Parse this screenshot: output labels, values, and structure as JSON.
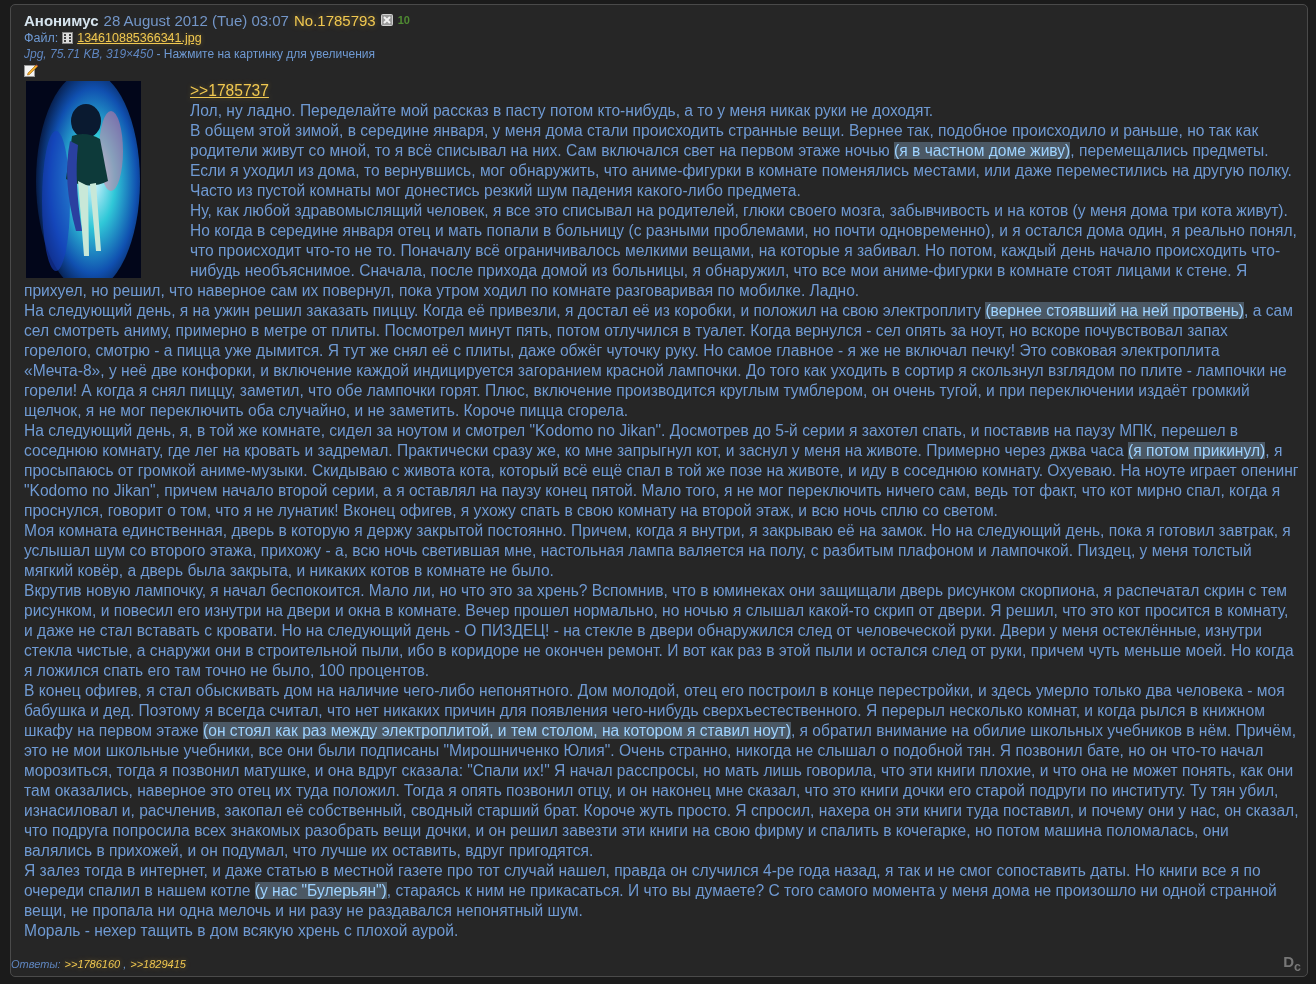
{
  "post": {
    "author": "Анонимус",
    "date": "28 August 2012 (Tue) 03:07",
    "number": "No.1785793",
    "score": "10",
    "file": {
      "label": "Файл:",
      "name": "134610885366341.jpg",
      "meta": "Jpg, 75.71 KB, 319×450",
      "hint": " - Нажмите на картинку для увеличения"
    },
    "thumbnail": {
      "kind": "picture"
    },
    "reply_link": ">>1785737",
    "paragraphs": [
      [
        {
          "text": "Лол, ну ладно. Переделайте мой рассказ в пасту потом кто-нибудь, а то у меня никак руки не доходят.",
          "spoiler": false
        }
      ],
      [
        {
          "text": "В общем этой зимой, в середине января, у меня дома стали происходить странные вещи. Вернее так, подобное происходило и раньше, но так как родители живут со мной, то я всё списывал на них. Сам включался свет на первом этаже ночью ",
          "spoiler": false
        },
        {
          "text": "(я в частном доме живу)",
          "spoiler": true
        },
        {
          "text": ", перемещались предметы. Если я уходил из дома, то вернувшись, мог обнаружить, что аниме-фигурки в комнате поменялись местами, или даже переместились на другую полку. Часто из пустой комнаты мог донестись резкий шум падения какого-либо предмета.",
          "spoiler": false
        }
      ],
      [
        {
          "text": "Ну, как любой здравомыслящий человек, я все это списывал на родителей, глюки своего мозга, забывчивость и на котов (у меня дома три кота живут). Но когда в середине января отец и мать попали в больницу (с разными проблемами, но почти одновременно), и я остался дома один, я реально понял, что происходит что-то не то. Поначалу всё ограничивалось мелкими вещами, на которые я забивал. Но потом, каждый день начало происходить что-нибудь необъяснимое. Сначала, после прихода домой из больницы, я обнаружил, что все мои аниме-фигурки в комнате стоят лицами к стене. Я прихуел, но решил, что наверное сам их повернул, пока утром ходил по комнате разговаривая по мобилке. Ладно.",
          "spoiler": false
        }
      ],
      [
        {
          "text": "На следующий день, я на ужин решил заказать пиццу. Когда её привезли, я достал её из коробки, и положил на свою электроплиту ",
          "spoiler": false
        },
        {
          "text": "(вернее стоявший на ней протвень)",
          "spoiler": true
        },
        {
          "text": ", а сам сел смотреть аниму, примерно в метре от плиты. Посмотрел минут пять, потом отлучился в туалет. Когда вернулся - сел опять за ноут, но вскоре почувствовал запах горелого, смотрю - а пицца уже дымится. Я тут же снял её с плиты, даже обжёг чуточку руку. Но самое главное - я же не включал печку! Это совковая электроплита «Мечта-8», у неё две конфорки, и включение каждой индицируется загоранием красной лампочки. До того как уходить в сортир я скользнул взглядом по плите - лампочки не горели! А когда я снял пиццу, заметил, что обе лампочки горят. Плюс, включение производится круглым тумблером, он очень тугой, и при переключении издаёт громкий щелчок, я не мог переключить оба случайно, и не заметить. Короче пицца сгорела.",
          "spoiler": false
        }
      ],
      [
        {
          "text": "На следующий день, я, в той же комнате, сидел за ноутом и смотрел \"Kodomo no Jikan\". Досмотрев до 5-й серии я захотел спать, и поставив на паузу МПК, перешел в соседнюю комнату, где лег на кровать и задремал. Практически сразу же, ко мне запрыгнул кот, и заснул у меня на животе. Примерно через джва часа ",
          "spoiler": false
        },
        {
          "text": "(я потом прикинул)",
          "spoiler": true
        },
        {
          "text": ", я просыпаюсь от громкой аниме-музыки. Скидываю с живота кота, который всё ещё спал в той же позе на животе, и иду в соседнюю комнату. Охуеваю. На ноуте играет опенинг \"Kodomo no Jikan\", причем начало второй серии, а я оставлял на паузу конец пятой. Мало того, я не мог переключить ничего сам, ведь тот факт, что кот мирно спал, когда я проснулся, говорит о том, что я не лунатик! Вконец офигев, я ухожу спать в свою комнату на второй этаж, и всю ночь сплю со светом.",
          "spoiler": false
        }
      ],
      [
        {
          "text": "Моя комната единственная, дверь в которую я держу закрытой постоянно. Причем, когда я внутри, я закрываю её на замок. Но на следующий день, пока я готовил завтрак, я услышал шум со второго этажа, прихожу - а, всю ночь светившая мне, настольная лампа валяется на полу, с разбитым плафоном и лампочкой. Пиздец, у меня толстый мягкий ковёр, а дверь была закрыта, и никаких котов в комнате не было.",
          "spoiler": false
        }
      ],
      [
        {
          "text": "Вкрутив новую лампочку, я начал беспокоится. Мало ли, но что это за хрень? Вспомнив, что в юминеках они защищали дверь рисунком скорпиона, я распечатал скрин с тем рисунком, и повесил его изнутри на двери и окна в комнате. Вечер прошел нормально, но ночью я слышал какой-то скрип от двери. Я решил, что это кот просится в комнату, и даже не стал вставать с кровати. Но на следующий день - О ПИЗДЕЦ! - на стекле в двери обнаружился след от человеческой руки. Двери у меня остеклённые, изнутри стекла чистые, а снаружи они в строительной пыли, ибо в коридоре не окончен ремонт. И вот как раз в этой пыли и остался след от руки, причем чуть меньше моей. Но когда я ложился спать его там точно не было, 100 процентов.",
          "spoiler": false
        }
      ],
      [
        {
          "text": "В конец офигев, я стал обыскивать дом на наличие чего-либо непонятного. Дом молодой, отец его построил в конце перестройки, и здесь умерло только два человека - моя бабушка и дед. Поэтому я всегда считал, что нет никаких причин для появления чего-нибудь сверхъестественного. Я перерыл несколько комнат, и когда рылся в книжном шкафу на первом этаже ",
          "spoiler": false
        },
        {
          "text": "(он стоял как раз между электроплитой, и тем столом, на котором я ставил ноут)",
          "spoiler": true
        },
        {
          "text": ", я обратил внимание на обилие школьных учебников в нём. Причём, это не мои школьные учебники, все они были подписаны \"Мирошниченко Юлия\". Очень странно, никогда не слышал о подобной тян. Я позвонил бате, но он что-то начал морозиться, тогда я позвонил матушке, и она вдруг сказала: \"Спали их!\" Я начал расспросы, но мать лишь говорила, что эти книги плохие, и что она не может понять, как они там оказались, наверное это отец их туда положил. Тогда я опять позвонил отцу, и он наконец мне сказал, что это книги дочки его старой подруги по институту. Ту тян убил, изнасиловал и, расчленив, закопал её собственный, сводный старший брат. Короче жуть просто. Я спросил, нахера он эти книги туда поставил, и почему они у нас, он сказал, что подруга попросила всех знакомых разобрать вещи дочки, и он решил завезти эти книги на свою фирму и спалить в кочегарке, но потом машина поломалась, они валялись в прихожей, и он подумал, что лучше их оставить, вдруг пригодятся.",
          "spoiler": false
        }
      ],
      [
        {
          "text": "Я залез тогда в интернет, и даже статью в местной газете про тот случай нашел, правда он случился 4-ре года назад, я так и не смог сопоставить даты. Но книги все я по очереди спалил в нашем котле ",
          "spoiler": false
        },
        {
          "text": "(у нас \"Булерьян\")",
          "spoiler": true
        },
        {
          "text": ", стараясь к ним не прикасаться. И что вы думаете? С того самого момента у меня дома не произошло ни одной странной вещи, не пропала ни одна мелочь и ни разу не раздавался непонятный шум.",
          "spoiler": false
        }
      ],
      [
        {
          "text": "Мораль - нехер тащить в дом всякую хрень с плохой аурой.",
          "spoiler": false
        }
      ]
    ],
    "replies": [
      {
        "kind": "label",
        "text": "Ответы:"
      },
      {
        "kind": "link",
        "text": ">>1786160"
      },
      {
        "kind": "text",
        "text": ","
      },
      {
        "kind": "link",
        "text": ">>1829415"
      }
    ],
    "corner_mark": "D$_{c}$"
  }
}
